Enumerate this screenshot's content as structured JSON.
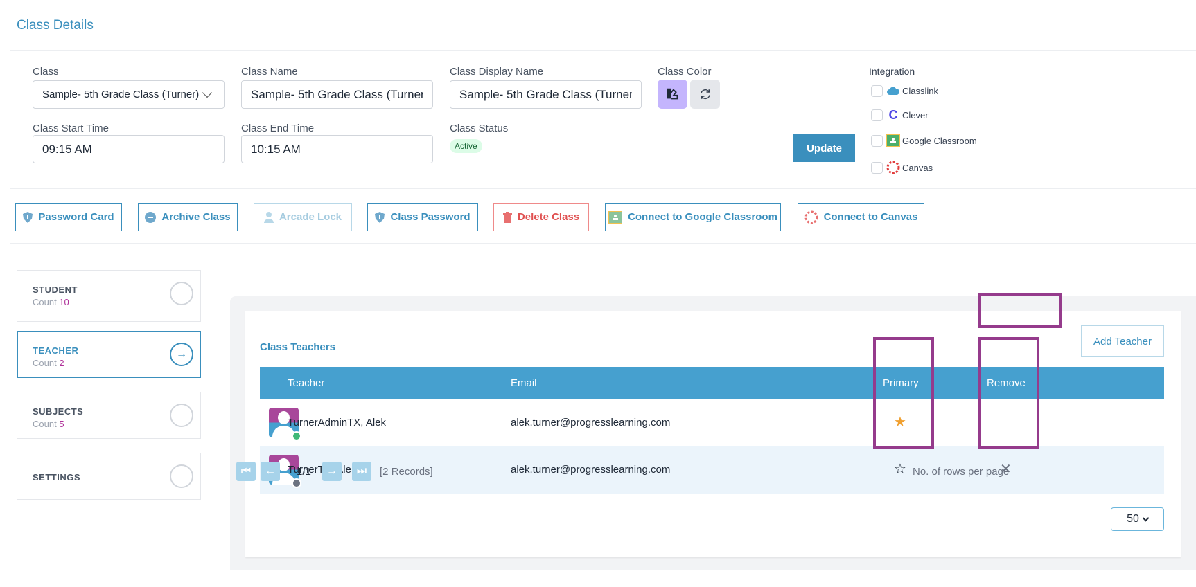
{
  "page": {
    "title": "Class Details"
  },
  "form": {
    "class": {
      "label": "Class",
      "value": "Sample- 5th Grade Class (Turner)"
    },
    "class_name": {
      "label": "Class Name",
      "value": "Sample- 5th Grade Class (Turner)"
    },
    "display_name": {
      "label": "Class Display Name",
      "value": "Sample- 5th Grade Class (Turner)"
    },
    "class_color": {
      "label": "Class Color",
      "swatch": "#c4b5fd"
    },
    "start_time": {
      "label": "Class Start Time",
      "value": "09:15 AM"
    },
    "end_time": {
      "label": "Class End Time",
      "value": "10:15 AM"
    },
    "status": {
      "label": "Class Status",
      "value": "Active"
    },
    "update_label": "Update"
  },
  "integration": {
    "title": "Integration",
    "items": [
      {
        "label": "Classlink",
        "icon": "classlink-icon",
        "checked": false
      },
      {
        "label": "Clever",
        "icon": "clever-icon",
        "checked": false
      },
      {
        "label": "Google Classroom",
        "icon": "google-classroom-icon",
        "checked": false
      },
      {
        "label": "Canvas",
        "icon": "canvas-icon",
        "checked": false
      }
    ]
  },
  "actions": {
    "password_card": "Password Card",
    "archive_class": "Archive Class",
    "arcade_lock": "Arcade Lock",
    "class_password": "Class Password",
    "delete_class": "Delete Class",
    "connect_google": "Connect to Google Classroom",
    "connect_canvas": "Connect to Canvas"
  },
  "sidebar": {
    "items": [
      {
        "title": "STUDENT",
        "count_label": "Count",
        "count": "10",
        "active": false
      },
      {
        "title": "TEACHER",
        "count_label": "Count",
        "count": "2",
        "active": true
      },
      {
        "title": "SUBJECTS",
        "count_label": "Count",
        "count": "5",
        "active": false
      },
      {
        "title": "SETTINGS",
        "active": false
      }
    ]
  },
  "teachers": {
    "title": "Class Teachers",
    "add_label": "Add Teacher",
    "columns": {
      "teacher": "Teacher",
      "email": "Email",
      "primary": "Primary",
      "remove": "Remove"
    },
    "rows": [
      {
        "name": "TurnerAdminTX, Alek",
        "email": "alek.turner@progresslearning.com",
        "primary": true,
        "status": "online",
        "removable": false
      },
      {
        "name": "TurnerTX, Alek",
        "email": "alek.turner@progresslearning.com",
        "primary": false,
        "status": "offline",
        "removable": true
      }
    ],
    "pagination": {
      "page": "1/1",
      "records": "[2 Records]",
      "rows_per_page_label": "No. of rows per page",
      "rows_per_page": "50"
    }
  }
}
